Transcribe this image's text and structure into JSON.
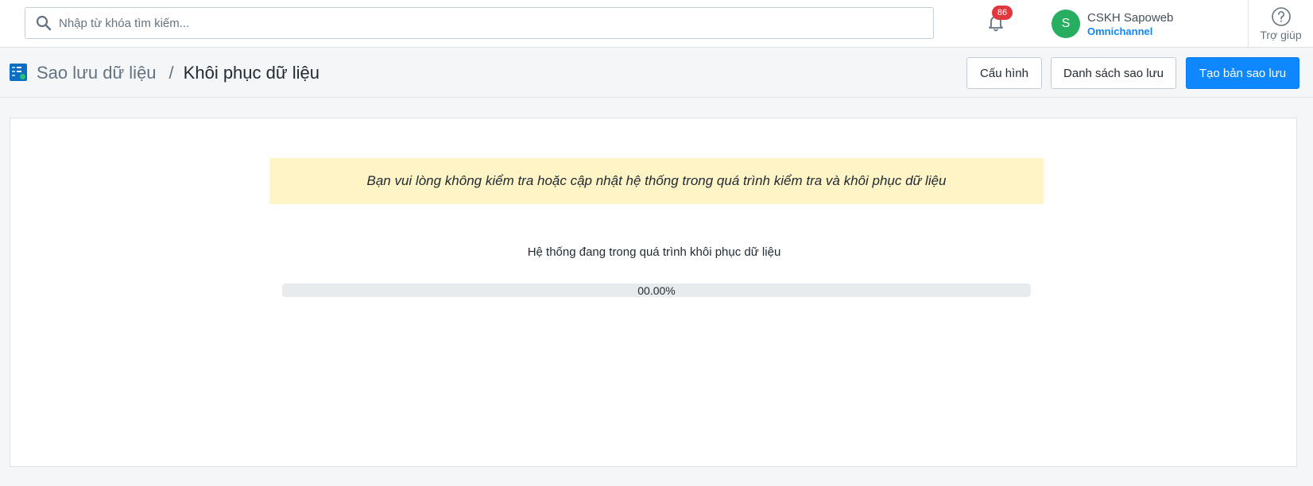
{
  "topbar": {
    "search_placeholder": "Nhập từ khóa tìm kiếm...",
    "notification_count": "86",
    "account": {
      "avatar_initial": "S",
      "name": "CSKH Sapoweb",
      "role": "Omnichannel"
    },
    "help_label": "Trợ giúp"
  },
  "header": {
    "breadcrumb_parent": "Sao lưu dữ liệu",
    "breadcrumb_separator": "/",
    "breadcrumb_current": "Khôi phục dữ liệu",
    "buttons": {
      "config": "Cấu hình",
      "backup_list": "Danh sách sao lưu",
      "create_backup": "Tạo bản sao lưu"
    }
  },
  "main": {
    "warning": "Bạn vui lòng không kiểm tra hoặc cập nhật hệ thống trong quá trình kiểm tra và khôi phục dữ liệu",
    "status": "Hệ thống đang trong quá trình khôi phục dữ liệu",
    "progress_label": "00.00%",
    "progress_fraction": 0
  },
  "colors": {
    "accent": "#0f88ff",
    "avatar": "#27ae60",
    "badge": "#e0383e",
    "warning_bg": "#fff4c6"
  },
  "icons": [
    "search-icon",
    "bell-icon",
    "help-circle-icon",
    "backup-app-icon"
  ]
}
